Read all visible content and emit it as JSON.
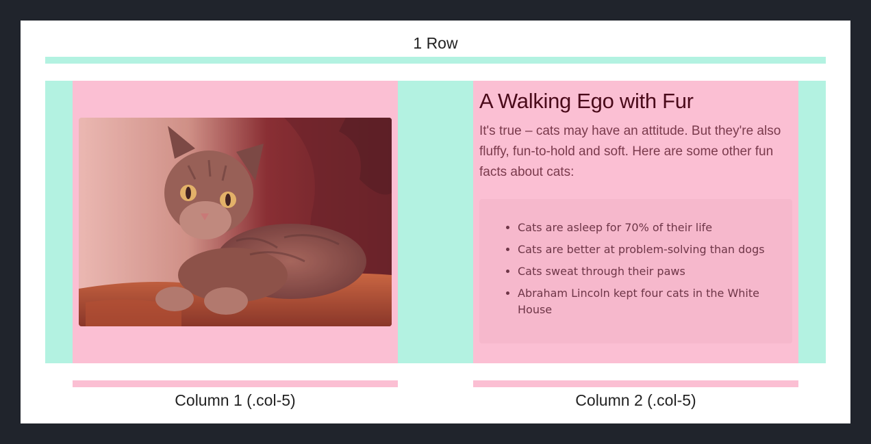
{
  "row": {
    "label": "1 Row"
  },
  "columns": [
    {
      "label": "Column 1 (.col-5)"
    },
    {
      "label": "Column 2 (.col-5)"
    }
  ],
  "content": {
    "heading": "A Walking Ego with Fur",
    "intro": "It's true – cats may have an attitude. But they're also fluffy, fun-to-hold and soft. Here are some other fun facts about cats:",
    "facts": [
      "Cats are asleep for 70% of their life",
      "Cats are better at problem-solving than dogs",
      "Cats sweat through their paws",
      "Abraham Lincoln kept four cats in the White House"
    ]
  },
  "colors": {
    "background": "#20242c",
    "row_highlight": "#b3f2e1",
    "column_highlight": "#fbbfd3",
    "heading": "#4a0a1a"
  },
  "image": {
    "subject": "tabby-cat-photo"
  }
}
